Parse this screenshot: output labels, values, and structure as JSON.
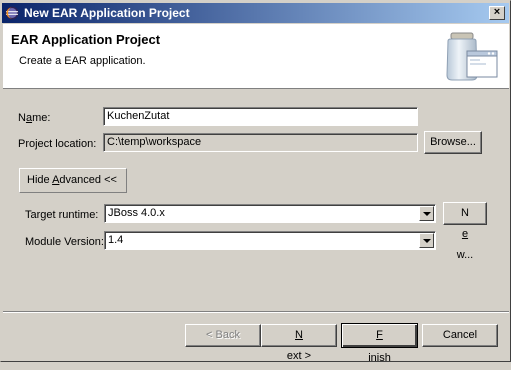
{
  "window": {
    "title": "New EAR Application Project",
    "close_label": "×"
  },
  "header": {
    "title": "EAR Application Project",
    "description": "Create a EAR application."
  },
  "form": {
    "name_label_pre": "N",
    "name_label_ul": "a",
    "name_label_post": "me:",
    "name_value": "KuchenZutat",
    "location_label": "Project location:",
    "location_value": "C:\\temp\\workspace",
    "browse_label": "Browse...",
    "advanced_toggle_pre": "Hide ",
    "advanced_toggle_ul": "A",
    "advanced_toggle_post": "dvanced <<",
    "runtime_label": "Target runtime:",
    "runtime_value": "JBoss 4.0.x",
    "new_label_pre": "N",
    "new_label_ul": "e",
    "new_label_post": "w...",
    "module_version_label": "Module Version:",
    "module_version_value": "1.4"
  },
  "footer": {
    "back_label": "< Back",
    "back_ul": "B",
    "next_label_pre": "",
    "next_label_ul": "N",
    "next_label_post": "ext >",
    "finish_label_pre": "",
    "finish_label_ul": "F",
    "finish_label_post": "inish",
    "cancel_label": "Cancel"
  },
  "icons": {
    "window_icon": "eclipse-icon",
    "header_graphic": "jar-window-icon"
  }
}
